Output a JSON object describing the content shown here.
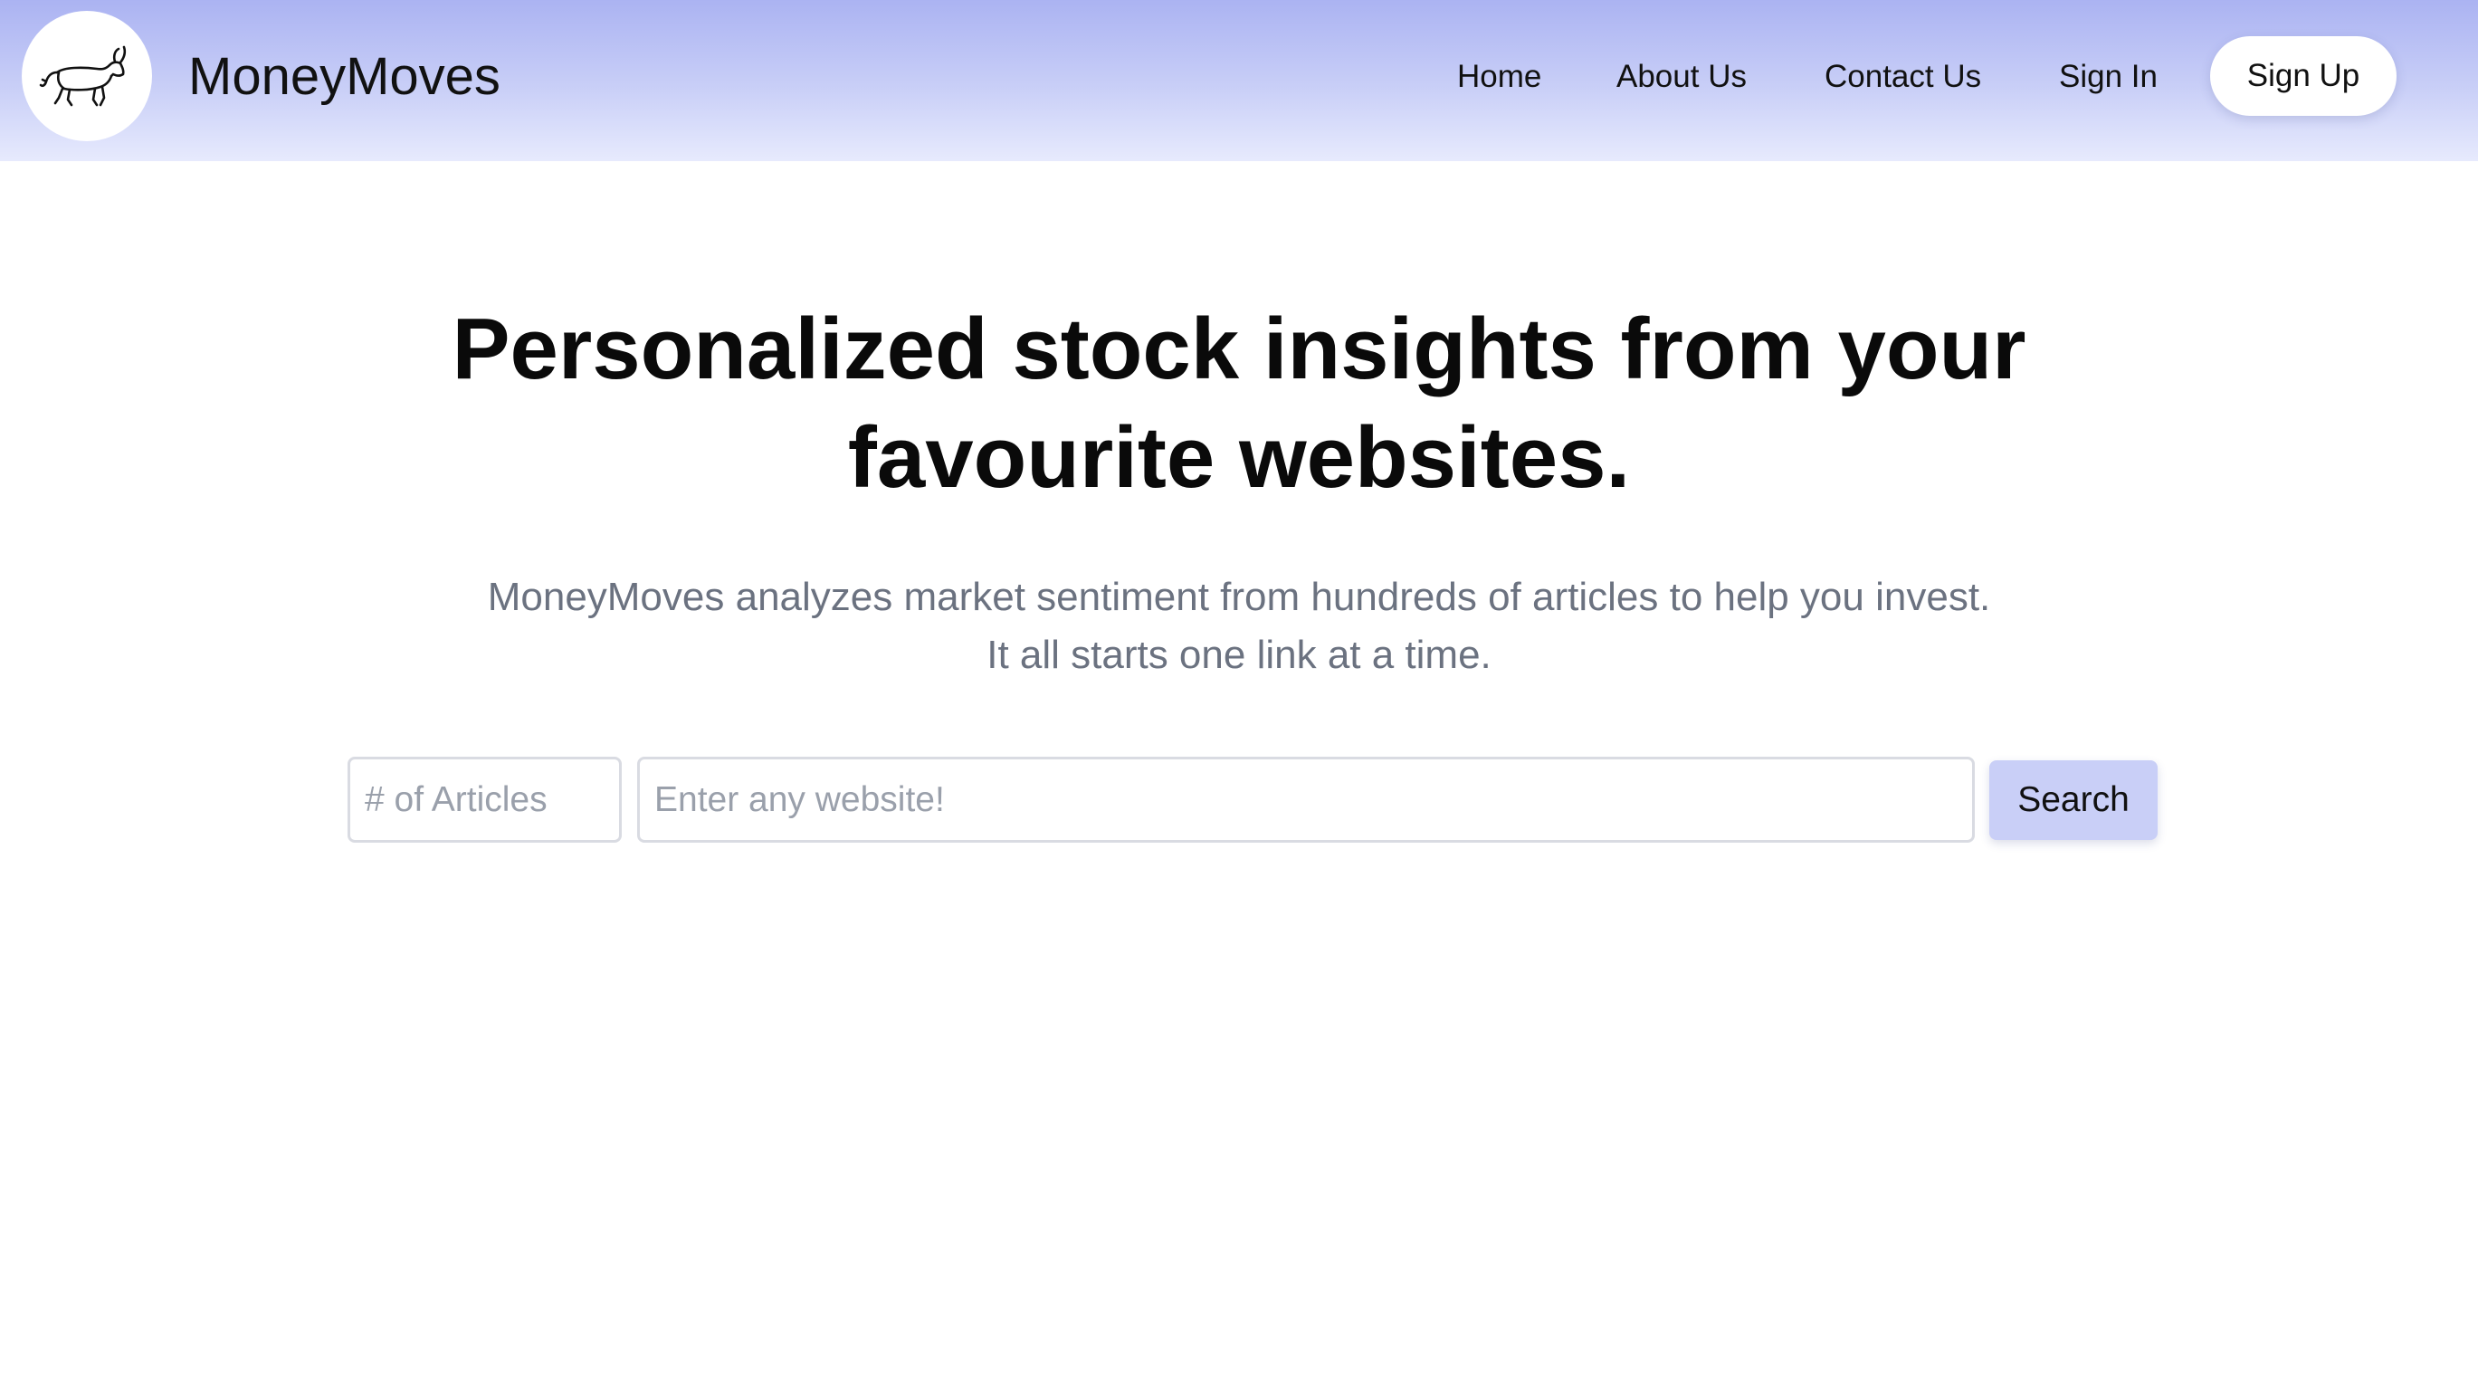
{
  "header": {
    "brand_name": "MoneyMoves",
    "logo_icon": "bull-icon",
    "nav": [
      {
        "label": "Home"
      },
      {
        "label": "About Us"
      },
      {
        "label": "Contact Us"
      },
      {
        "label": "Sign In"
      }
    ],
    "signup_label": "Sign Up"
  },
  "hero": {
    "title_line1": "Personalized stock insights from your",
    "title_line2": "favourite websites.",
    "subtitle_line1": "MoneyMoves analyzes market sentiment from hundreds of articles to help you invest.",
    "subtitle_line2": "It all starts one link at a time."
  },
  "search": {
    "articles_placeholder": "# of Articles",
    "website_placeholder": "Enter any website!",
    "button_label": "Search"
  },
  "colors": {
    "navbar_gradient_top": "#abb3f2",
    "navbar_gradient_bottom": "#e7eafd",
    "search_button_bg": "#c9cff7",
    "subtitle_text": "#6b7280"
  }
}
